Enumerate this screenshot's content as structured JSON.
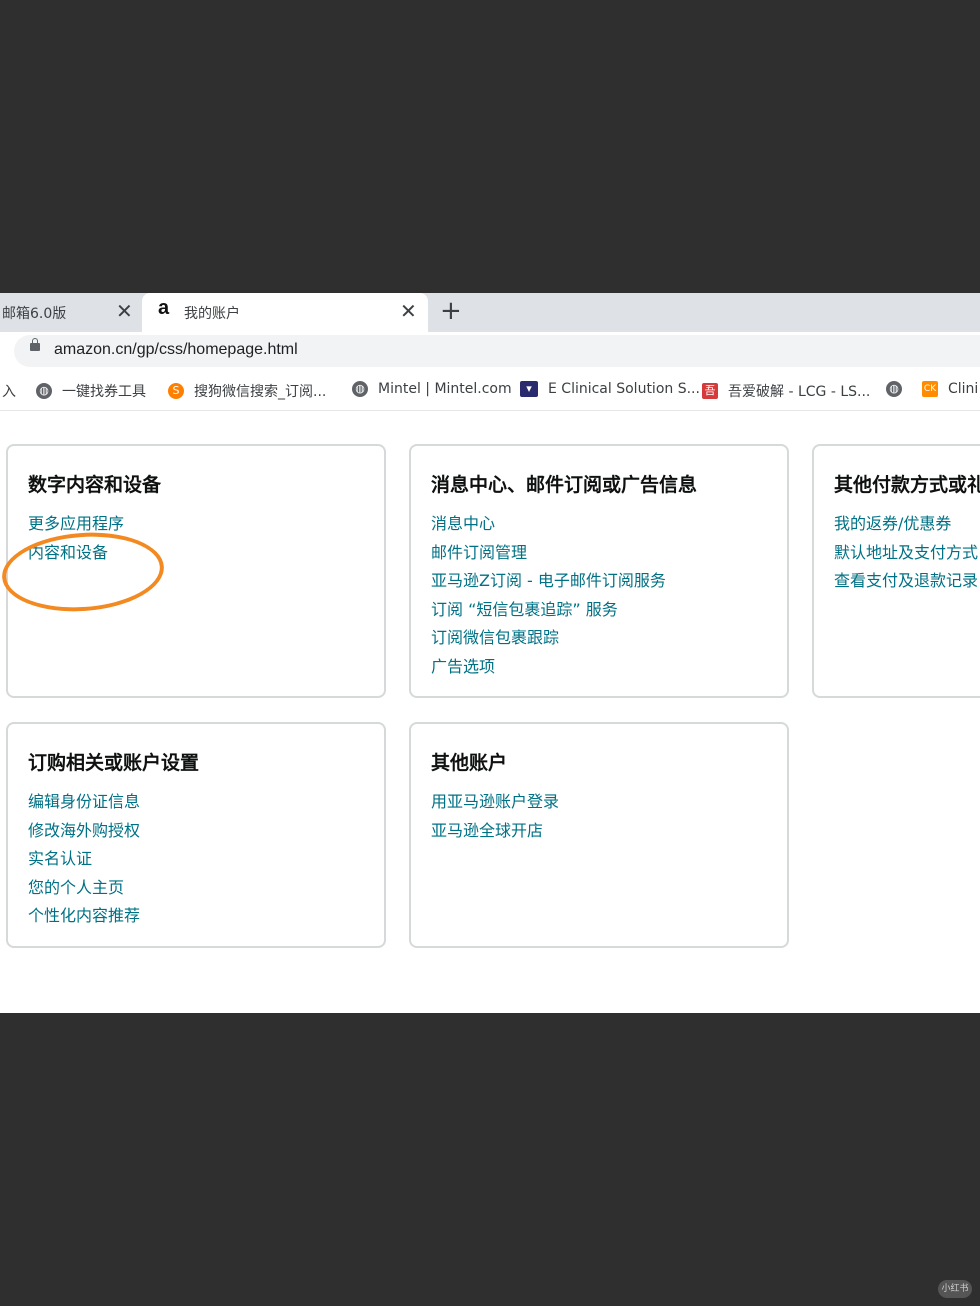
{
  "browser": {
    "tabs": [
      {
        "title": "邮箱6.0版",
        "close": "✕"
      },
      {
        "title": "我的账户",
        "favicon": "a",
        "close": "✕"
      }
    ],
    "new_tab": "+",
    "url": "amazon.cn/gp/css/homepage.html",
    "bookmarks": [
      {
        "label": "入"
      },
      {
        "label": "一键找券工具",
        "icon": "globe-icon"
      },
      {
        "label": "搜狗微信搜索_订阅...",
        "icon": "sogou-icon"
      },
      {
        "label": "Mintel | Mintel.com",
        "icon": "globe-icon"
      },
      {
        "label": "E Clinical Solution S...",
        "icon": "ec-icon"
      },
      {
        "label": "吾爱破解 - LCG - LS...",
        "icon": "wuai-icon"
      },
      {
        "label": "",
        "icon": "globe-icon"
      },
      {
        "label": "Clini",
        "icon": "ck-icon",
        "icon_text": "CK"
      }
    ]
  },
  "cards": [
    {
      "title": "数字内容和设备",
      "links": [
        "更多应用程序",
        "内容和设备"
      ]
    },
    {
      "title": "消息中心、邮件订阅或广告信息",
      "links": [
        "消息中心",
        "邮件订阅管理",
        "亚马逊Z订阅 - 电子邮件订阅服务",
        "订阅 “短信包裹追踪” 服务",
        "订阅微信包裹跟踪",
        "广告选项"
      ]
    },
    {
      "title": "其他付款方式或礼",
      "links": [
        "我的返券/优惠券",
        "默认地址及支付方式",
        "查看支付及退款记录"
      ]
    },
    {
      "title": "订购相关或账户设置",
      "links": [
        "编辑身份证信息",
        "修改海外购授权",
        "实名认证",
        "您的个人主页",
        "个性化内容推荐"
      ]
    },
    {
      "title": "其他账户",
      "links": [
        "用亚马逊账户登录",
        "亚马逊全球开店"
      ]
    }
  ],
  "annotation_color": "#f28a21",
  "link_color": "#007185",
  "watermark": "小红书"
}
